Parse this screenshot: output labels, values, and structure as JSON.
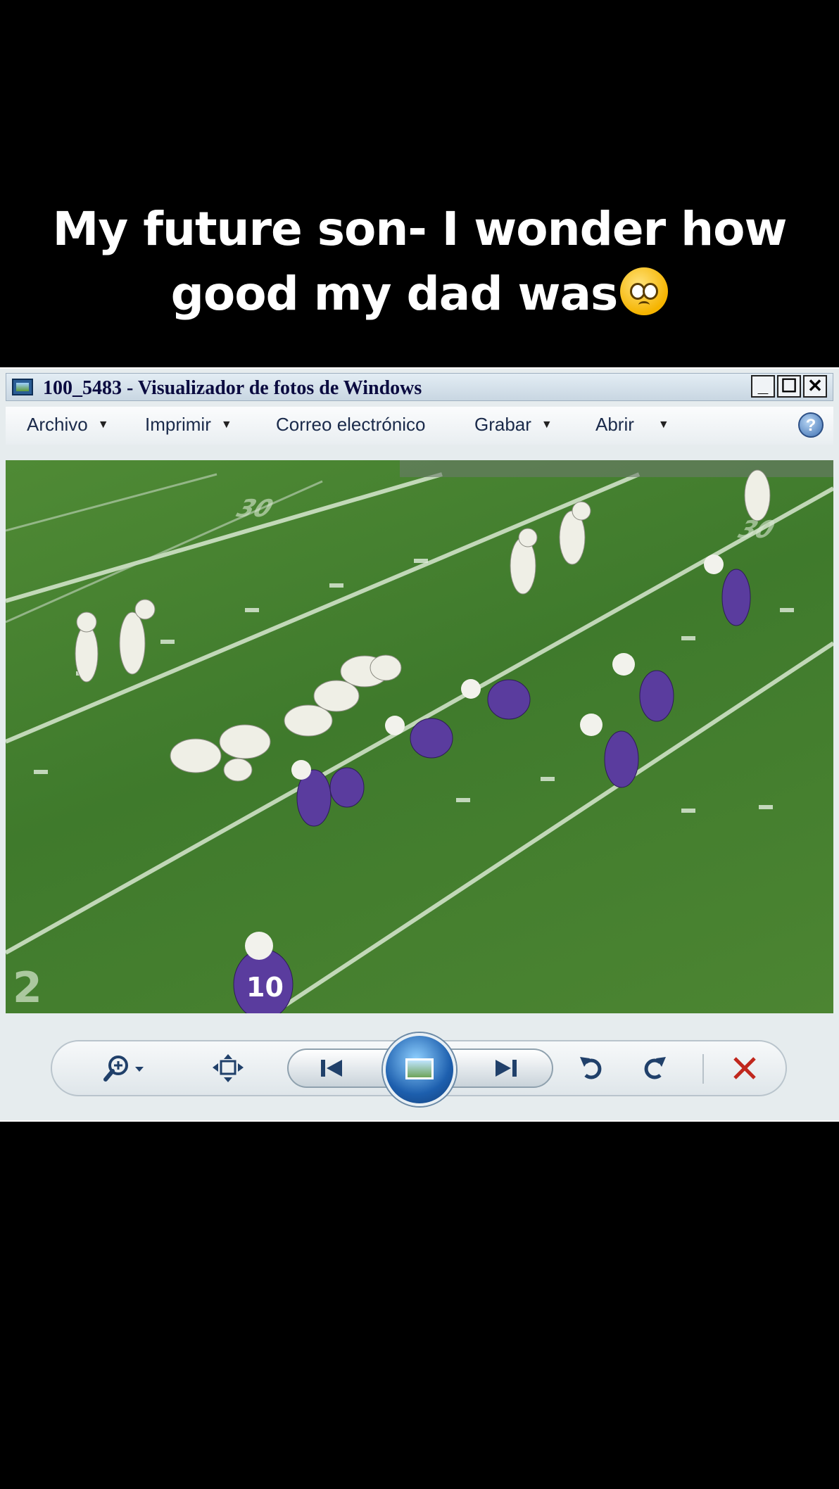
{
  "caption": {
    "line1": "My future son- I wonder how",
    "line2": "good my dad was"
  },
  "window": {
    "title": "100_5483 - Visualizador de fotos de Windows",
    "min_symbol": "_",
    "max_symbol": "☐",
    "close_symbol": "✕"
  },
  "menu": {
    "items": [
      {
        "label": "Archivo",
        "dropdown": true
      },
      {
        "label": "Imprimir",
        "dropdown": true
      },
      {
        "label": "Correo electrónico",
        "dropdown": false
      },
      {
        "label": "Grabar",
        "dropdown": true
      },
      {
        "label": "Abrir",
        "dropdown": true
      }
    ],
    "help_symbol": "?"
  },
  "photo": {
    "jersey_number": "10"
  },
  "controls": {
    "zoom": "zoom-icon",
    "fit": "fit-window-icon",
    "prev": "previous-icon",
    "slideshow": "slideshow-icon",
    "next": "next-icon",
    "rotate_left": "rotate-left-icon",
    "rotate_right": "rotate-right-icon",
    "delete": "delete-icon",
    "delete_color": "#c0271d"
  }
}
